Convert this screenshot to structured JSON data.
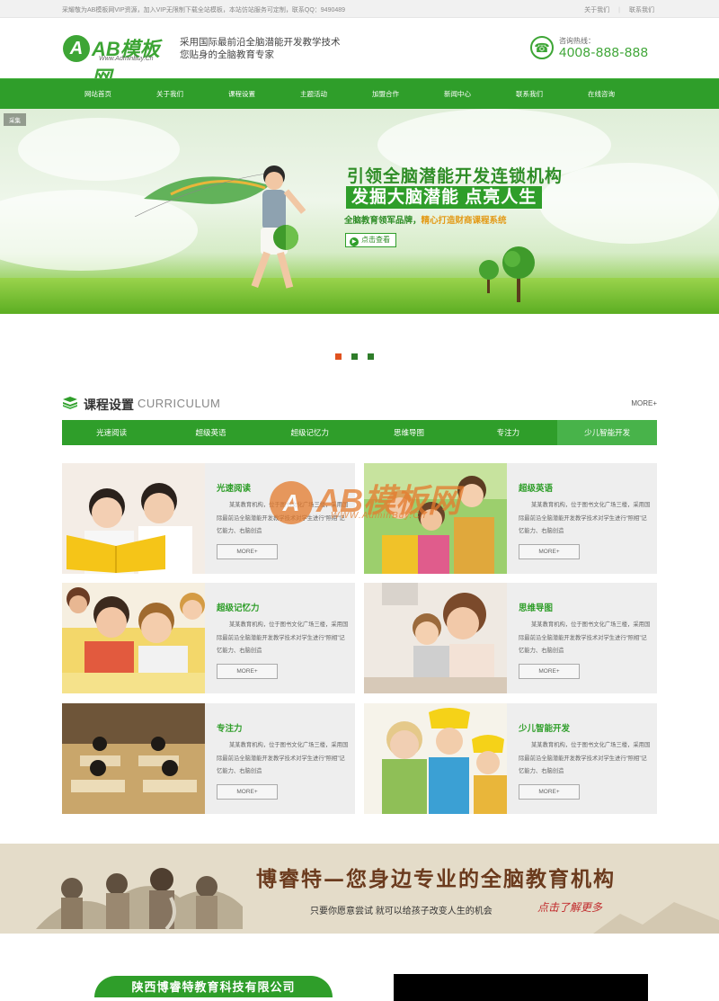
{
  "topbar": {
    "notice": "采耀敬为AB模板网VIP资源，加入VIP无限制下载全站模板，本站仿站服务可定制，联系QQ：9490489",
    "links": [
      "关于我们",
      "联系我们"
    ]
  },
  "header": {
    "logo_text": "AB模板网",
    "logo_badge": "A",
    "logo_domain": "Www.AdminBuy.Cn",
    "slogan_line1": "采用国际最前沿全脑潜能开发教学技术",
    "slogan_line2": "您贴身的全脑教育专家",
    "hotline_label": "咨询热线：",
    "hotline_number": "4008-888-888"
  },
  "nav": {
    "items": [
      "网站首页",
      "关于我们",
      "课程设置",
      "主题活动",
      "加盟合作",
      "新闻中心",
      "联系我们",
      "在线咨询"
    ]
  },
  "banner": {
    "tag": "采集",
    "line1": "引领全脑潜能开发连锁机构",
    "line2": "发掘大脑潜能  点亮人生",
    "line3_a": "全脑教育领军品牌，",
    "line3_b": "精心打造财商课程系统",
    "button": "点击查看"
  },
  "slider_dots": [
    {
      "color": "#e0521f",
      "active": true
    },
    {
      "color": "#2f7d2a",
      "active": false
    },
    {
      "color": "#2f7d2a",
      "active": false
    }
  ],
  "section": {
    "title_cn": "课程设置",
    "title_en": "CURRICULUM",
    "more": "MORE+"
  },
  "tabs": [
    "光速阅读",
    "超级英语",
    "超级记忆力",
    "思维导图",
    "专注力",
    "少儿智能开发"
  ],
  "cards": [
    {
      "title": "光速阅读",
      "desc": "某某教育机构，位于图书文化广场三楼，采用国际最前沿全脑潜能开发教学技术对学生进行“照相”记忆能力、右脑创造",
      "more": "MORE+"
    },
    {
      "title": "超级英语",
      "desc": "某某教育机构，位于图书文化广场三楼，采用国际最前沿全脑潜能开发教学技术对学生进行“照相”记忆能力、右脑创造",
      "more": "MORE+"
    },
    {
      "title": "超级记忆力",
      "desc": "某某教育机构，位于图书文化广场三楼，采用国际最前沿全脑潜能开发教学技术对学生进行“照相”记忆能力、右脑创造",
      "more": "MORE+"
    },
    {
      "title": "思维导图",
      "desc": "某某教育机构，位于图书文化广场三楼，采用国际最前沿全脑潜能开发教学技术对学生进行“照相”记忆能力、右脑创造",
      "more": "MORE+"
    },
    {
      "title": "专注力",
      "desc": "某某教育机构，位于图书文化广场三楼，采用国际最前沿全脑潜能开发教学技术对学生进行“照相”记忆能力、右脑创造",
      "more": "MORE+"
    },
    {
      "title": "少儿智能开发",
      "desc": "某某教育机构，位于图书文化广场三楼，采用国际最前沿全脑潜能开发教学技术对学生进行“照相”记忆能力、右脑创造",
      "more": "MORE+"
    }
  ],
  "watermark": {
    "badge": "A",
    "text": "AB模板网",
    "url": "WWW.AdminBuy.Cn"
  },
  "promo": {
    "main": "博睿特—您身边专业的全脑教育机构",
    "sub": "只要你愿意尝试 就可以给孩子改变人生的机会",
    "cta": "点击了解更多"
  },
  "company": {
    "name": "陕西博睿特教育科技有限公司"
  },
  "colors": {
    "primary": "#2f9e2a",
    "tab_active": "#48b34a",
    "accent_orange": "#e0521f",
    "promo_bg": "#e4dcc9"
  }
}
